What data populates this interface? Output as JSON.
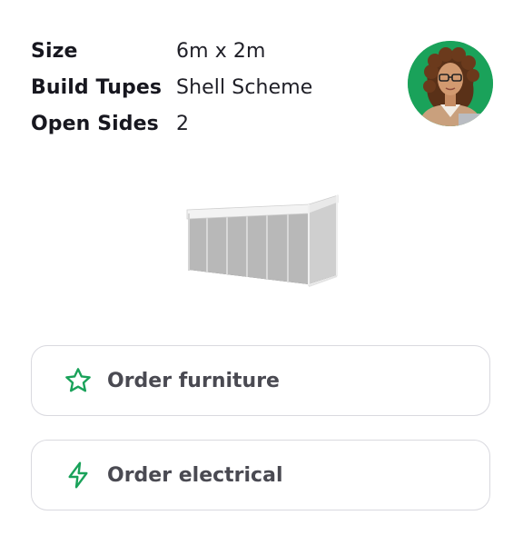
{
  "specs": {
    "size_label": "Size",
    "size_value": "6m x 2m",
    "build_label": "Build Tupes",
    "build_value": "Shell Scheme",
    "sides_label": "Open Sides",
    "sides_value": "2"
  },
  "avatar": {
    "icon": "user-avatar",
    "background": "#1aa25a"
  },
  "booth": {
    "icon": "shell-scheme-booth-image"
  },
  "actions": [
    {
      "label": "Order furniture",
      "icon": "star-icon"
    },
    {
      "label": "Order electrical",
      "icon": "lightning-icon"
    }
  ],
  "colors": {
    "accent": "#1aa25a",
    "border": "#d9d9df",
    "button_text": "#4a4a52"
  }
}
